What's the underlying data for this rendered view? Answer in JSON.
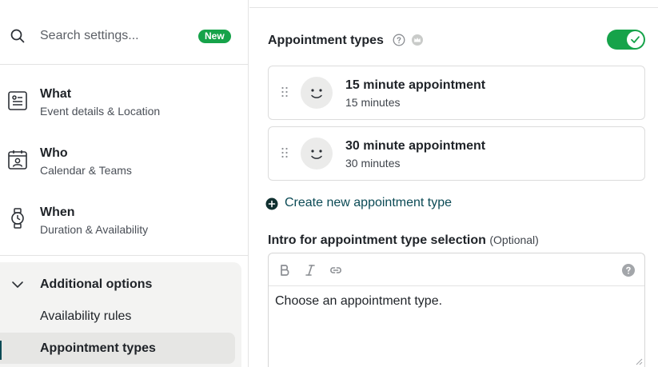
{
  "search": {
    "placeholder": "Search settings...",
    "badge": "New",
    "badge_color": "#16a34a"
  },
  "nav": [
    {
      "title": "What",
      "subtitle": "Event details & Location",
      "icon": "id-card-icon"
    },
    {
      "title": "Who",
      "subtitle": "Calendar & Teams",
      "icon": "calendar-person-icon"
    },
    {
      "title": "When",
      "subtitle": "Duration & Availability",
      "icon": "watch-icon"
    }
  ],
  "group": {
    "title": "Additional options",
    "icon": "chevron-down-icon",
    "items": [
      {
        "label": "Availability rules",
        "active": false
      },
      {
        "label": "Appointment types",
        "active": true
      }
    ]
  },
  "main": {
    "section_title": "Appointment types",
    "toggle_on": true,
    "accent": "#0b4a55",
    "toggle_color": "#16a34a",
    "appointments": [
      {
        "name": "15 minute appointment",
        "duration": "15 minutes",
        "icon": "smiley-face-icon"
      },
      {
        "name": "30 minute appointment",
        "duration": "30 minutes",
        "icon": "smiley-face-icon"
      }
    ],
    "create_label": "Create new appointment type",
    "intro_label": "Intro for appointment type selection",
    "intro_optional": "(Optional)",
    "editor_text": "Choose an appointment type.",
    "toolbar_icons": [
      "bold-icon",
      "italic-icon",
      "link-icon",
      "help-icon"
    ]
  }
}
